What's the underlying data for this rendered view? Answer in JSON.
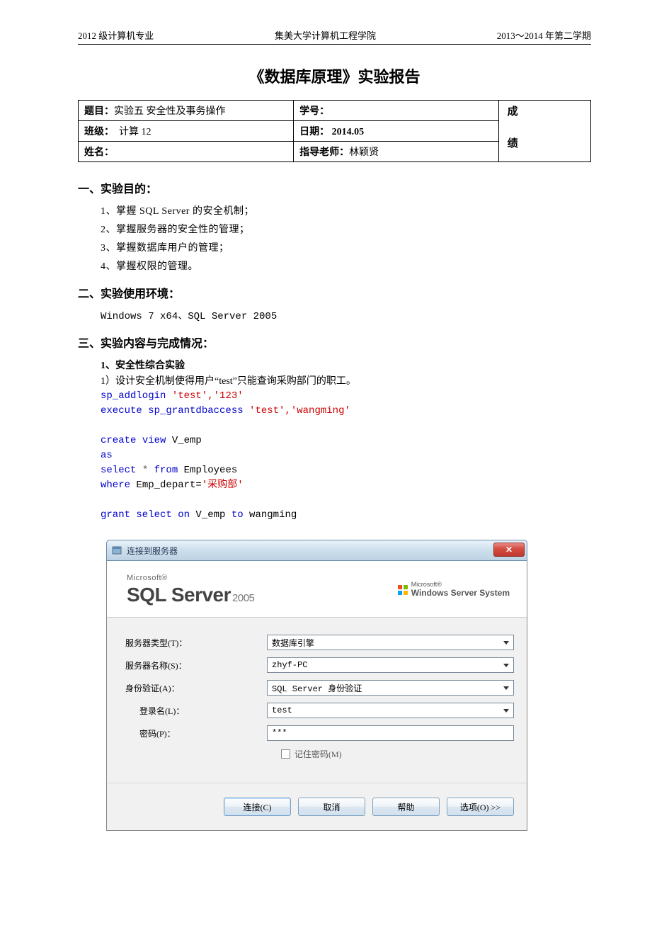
{
  "header": {
    "left": "2012 级计算机专业",
    "center": "集美大学计算机工程学院",
    "right": "2013～2014 年第二学期"
  },
  "title": "《数据库原理》实验报告",
  "info": {
    "topic_label": "题目：",
    "topic_value": "实验五  安全性及事务操作",
    "sid_label": "学号：",
    "sid_value": "",
    "class_label": "班级：",
    "class_value": "计算 12",
    "date_label": "日期：",
    "date_value": "2014.05",
    "name_label": "姓名：",
    "name_value": "",
    "teacher_label": "指导老师：",
    "teacher_value": "林颖贤",
    "grade_top": "成",
    "grade_bottom": "绩"
  },
  "sections": {
    "s1_heading": "一、实验目的：",
    "s1_items": [
      "1、掌握 SQL Server 的安全机制；",
      "2、掌握服务器的安全性的管理；",
      "3、掌握数据库用户的管理；",
      "4、掌握权限的管理。"
    ],
    "s2_heading": "二、实验使用环境：",
    "s2_env": "Windows 7 x64、SQL Server 2005",
    "s3_heading": "三、实验内容与完成情况：",
    "s3_sub": "1、安全性综合实验",
    "s3_task": "1）设计安全机制使得用户“test”只能查询采购部门的职工。"
  },
  "code": {
    "l1_kw": "sp_addlogin ",
    "l1_str": "'test','123'",
    "l2_kw": "execute sp_grantdbaccess ",
    "l2_str": "'test','wangming'",
    "l3_a": "create ",
    "l3_b": "view",
    "l3_c": " V_emp",
    "l4": "as",
    "l5_a": "select ",
    "l5_b": "* ",
    "l5_c": "from",
    "l5_d": " Employees",
    "l6_a": "where",
    "l6_b": " Emp_depart=",
    "l6_c": "'采购部'",
    "l7_a": "grant select on",
    "l7_b": " V_emp ",
    "l7_c": "to",
    "l7_d": " wangming"
  },
  "dialog": {
    "title": "连接到服务器",
    "close": "✕",
    "logo_ms": "Microsoft®",
    "logo_sql": "SQL Server",
    "logo_year": "2005",
    "wss_ms": "Microsoft®",
    "wss": "Windows Server System",
    "rows": {
      "server_type_label": "服务器类型(T)：",
      "server_type_value": "数据库引擎",
      "server_name_label": "服务器名称(S)：",
      "server_name_value": "zhyf-PC",
      "auth_label": "身份验证(A)：",
      "auth_value": "SQL Server 身份验证",
      "login_label": "登录名(L)：",
      "login_value": "test",
      "pwd_label": "密码(P)：",
      "pwd_value": "***"
    },
    "remember": "记住密码(M)",
    "buttons": {
      "connect": "连接(C)",
      "cancel": "取消",
      "help": "帮助",
      "options": "选项(O) >>"
    }
  }
}
